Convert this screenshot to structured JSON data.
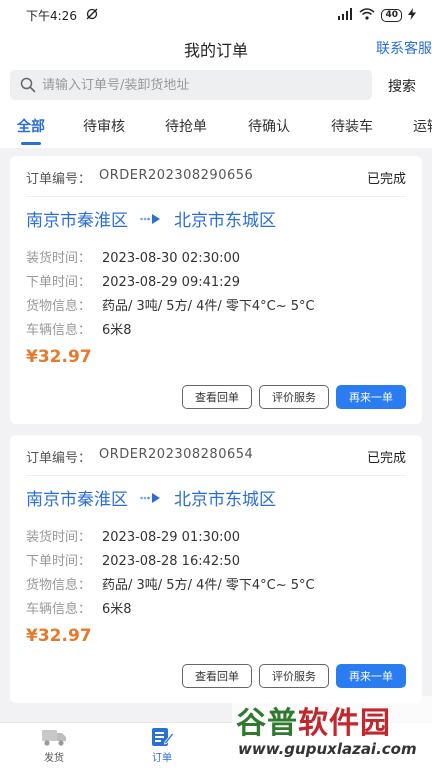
{
  "status_bar": {
    "time": "下午4:26",
    "battery": "40"
  },
  "header": {
    "title": "我的订单",
    "service_link": "联系客服"
  },
  "search": {
    "placeholder": "请输入订单号/装卸货地址",
    "button": "搜索"
  },
  "tabs": [
    {
      "label": "全部",
      "active": true
    },
    {
      "label": "待审核"
    },
    {
      "label": "待抢单"
    },
    {
      "label": "待确认"
    },
    {
      "label": "待装车"
    },
    {
      "label": "运输"
    }
  ],
  "order_no_label": "订单编号：",
  "field_labels": {
    "load_time": "装货时间：",
    "order_time": "下单时间：",
    "cargo": "货物信息：",
    "vehicle": "车辆信息："
  },
  "action_labels": {
    "view_receipt": "查看回单",
    "rate": "评价服务",
    "reorder": "再来一单"
  },
  "orders": [
    {
      "order_no": "ORDER202308290656",
      "status": "已完成",
      "from": "南京市秦淮区",
      "to": "北京市东城区",
      "load_time": "2023-08-30 02:30:00",
      "order_time": "2023-08-29 09:41:29",
      "cargo": "药品/ 3吨/ 5方/ 4件/ 零下4°C~ 5°C",
      "vehicle": "6米8",
      "price": "¥32.97"
    },
    {
      "order_no": "ORDER202308280654",
      "status": "已完成",
      "from": "南京市秦淮区",
      "to": "北京市东城区",
      "load_time": "2023-08-29 01:30:00",
      "order_time": "2023-08-28 16:42:50",
      "cargo": "药品/ 3吨/ 5方/ 4件/ 零下4°C~ 5°C",
      "vehicle": "6米8",
      "price": "¥32.97"
    }
  ],
  "bottom_nav": [
    {
      "label": "发货",
      "icon": "truck-icon",
      "active": false
    },
    {
      "label": "订单",
      "icon": "order-list-icon",
      "active": true
    }
  ],
  "watermark": {
    "brand_part1": "谷普",
    "brand_part2": "软件园",
    "url": "www.gupuxlazai.com"
  },
  "colors": {
    "accent": "#2a6fd6",
    "price": "#e8782a",
    "primary_button": "#2a7cf0"
  }
}
